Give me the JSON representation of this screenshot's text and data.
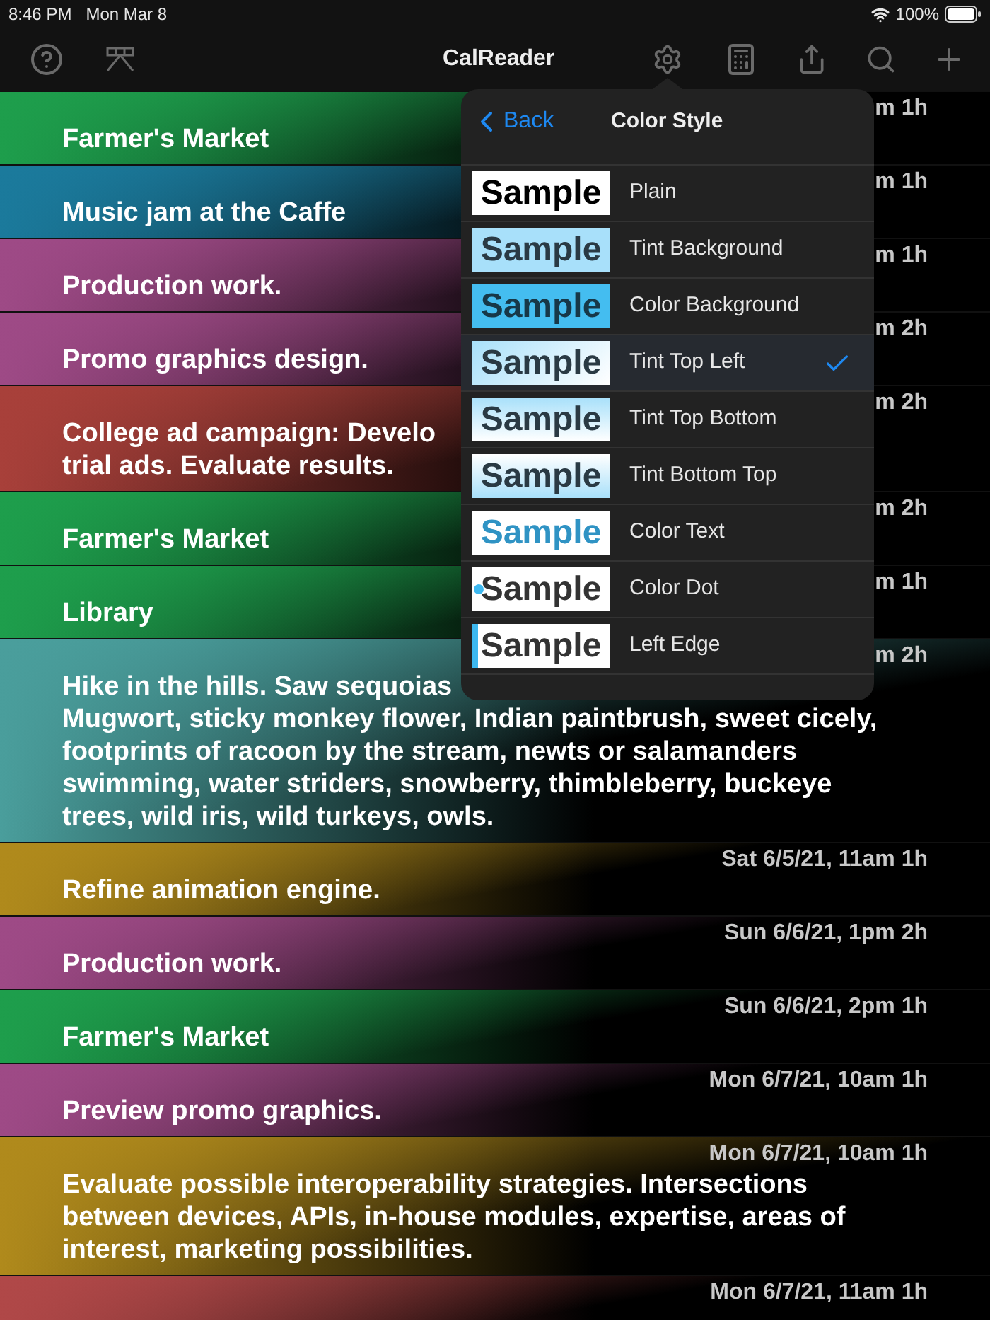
{
  "status_bar": {
    "time": "8:46 PM",
    "date": "Mon Mar 8",
    "battery": "100%"
  },
  "toolbar": {
    "title": "CalReader"
  },
  "rows": [
    {
      "time": "m 1h",
      "lines": [
        "Farmer's Market"
      ],
      "color": "#1e9e4c"
    },
    {
      "time": "m 1h",
      "lines": [
        "Music jam at the Caffe"
      ],
      "color": "#1b7a9c"
    },
    {
      "time": "m 1h",
      "lines": [
        "Production work."
      ],
      "color": "#9e4a86"
    },
    {
      "time": "m 2h",
      "lines": [
        "Promo graphics design."
      ],
      "color": "#9e4a86"
    },
    {
      "time": "m 2h",
      "lines": [
        "College ad campaign: Develo",
        "trial ads. Evaluate results."
      ],
      "color": "#a8403a"
    },
    {
      "time": "m 2h",
      "lines": [
        "Farmer's Market"
      ],
      "color": "#1e9e4c"
    },
    {
      "time": "m 1h",
      "lines": [
        "Library"
      ],
      "color": "#1e9e4c"
    },
    {
      "time": "m 2h",
      "lines": [
        "Hike in the hills. Saw sequoias",
        "Mugwort, sticky monkey flower, Indian paintbrush, sweet cicely,",
        "footprints of racoon by the stream, newts or salamanders",
        "swimming, water striders, snowberry, thimbleberry, buckeye",
        "trees, wild iris, wild turkeys, owls."
      ],
      "color": "#4a9e9c"
    },
    {
      "time": "Sat 6/5/21, 11am 1h",
      "lines": [
        "Refine animation engine."
      ],
      "color": "#b08a1c"
    },
    {
      "time": "Sun 6/6/21, 1pm 2h",
      "lines": [
        "Production work."
      ],
      "color": "#9e4a86"
    },
    {
      "time": "Sun 6/6/21, 2pm 1h",
      "lines": [
        "Farmer's Market"
      ],
      "color": "#1e9e4c"
    },
    {
      "time": "Mon 6/7/21, 10am 1h",
      "lines": [
        "Preview promo graphics."
      ],
      "color": "#9e4a86"
    },
    {
      "time": "Mon 6/7/21, 10am 1h",
      "lines": [
        "Evaluate possible interoperability strategies. Intersections",
        "between devices, APIs, in-house modules, expertise, areas of",
        "interest, marketing possibilities."
      ],
      "color": "#b08a1c"
    },
    {
      "time": "Mon 6/7/21, 11am 1h",
      "lines": [],
      "color": "#b04848"
    }
  ],
  "popover": {
    "back": "Back",
    "title": "Color Style",
    "items": [
      {
        "kind": "plain",
        "sample": "Sample",
        "label": "Plain",
        "selected": false
      },
      {
        "kind": "tint-background",
        "sample": "Sample",
        "label": "Tint Background",
        "selected": false
      },
      {
        "kind": "color-background",
        "sample": "Sample",
        "label": "Color Background",
        "selected": false
      },
      {
        "kind": "tint-top-left",
        "sample": "Sample",
        "label": "Tint Top Left",
        "selected": true
      },
      {
        "kind": "tint-top-bottom",
        "sample": "Sample",
        "label": "Tint Top Bottom",
        "selected": false
      },
      {
        "kind": "tint-bottom-top",
        "sample": "Sample",
        "label": "Tint Bottom Top",
        "selected": false
      },
      {
        "kind": "color-text",
        "sample": "Sample",
        "label": "Color Text",
        "selected": false
      },
      {
        "kind": "color-dot",
        "sample": "Sample",
        "label": "Color Dot",
        "selected": false
      },
      {
        "kind": "left-edge",
        "sample": "Sample",
        "label": "Left Edge",
        "selected": false
      }
    ]
  }
}
